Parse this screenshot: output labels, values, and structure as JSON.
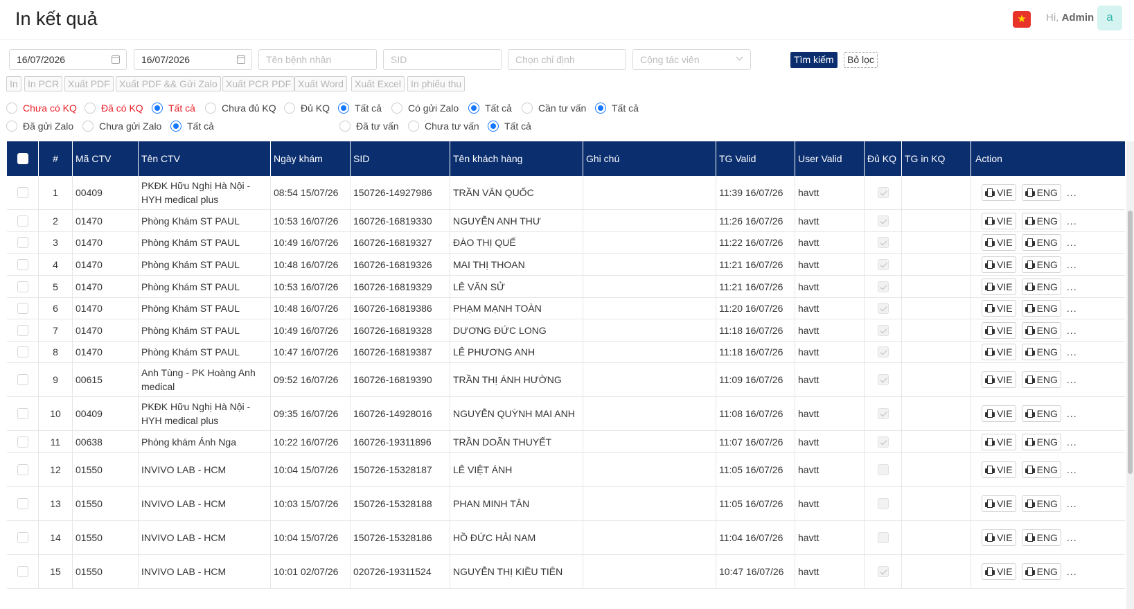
{
  "header": {
    "title": "In kết quả",
    "greeting": "Hi,",
    "user": "Admin",
    "avatar": "a",
    "flag_icon": "vietnam-flag-icon"
  },
  "filters": {
    "from_date": "16/07/2026",
    "to_date": "16/07/2026",
    "patient_placeholder": "Tên bệnh nhân",
    "sid_placeholder": "SID",
    "order_placeholder": "Chọn chỉ định",
    "ctv_placeholder": "Cộng tác viên",
    "search_label": "Tìm kiếm",
    "filter_label": "Bỏ lọc"
  },
  "toolbar": {
    "buttons": [
      "In",
      "In PCR",
      "Xuất PDF",
      "Xuất PDF && Gửi Zalo",
      "Xuất PCR PDF",
      "Xuất Word",
      "Xuất Excel",
      "In phiếu thu"
    ]
  },
  "radio_groups": [
    {
      "options": [
        {
          "label": "Chưa có KQ",
          "checked": false
        },
        {
          "label": "Đã có KQ",
          "checked": false
        },
        {
          "label": "Tất cả",
          "checked": true
        }
      ]
    },
    {
      "options": [
        {
          "label": "Chưa đủ KQ",
          "checked": false
        },
        {
          "label": "Đủ KQ",
          "checked": false
        },
        {
          "label": "Tất cả",
          "checked": true
        }
      ]
    },
    {
      "options": [
        {
          "label": "Có gửi Zalo",
          "checked": false
        },
        {
          "label": "Tất cả",
          "checked": true
        }
      ]
    },
    {
      "options": [
        {
          "label": "Cần tư vấn",
          "checked": false
        },
        {
          "label": "Tất cả",
          "checked": true
        }
      ]
    },
    {
      "options": [
        {
          "label": "Đã gửi Zalo",
          "checked": false
        },
        {
          "label": "Chưa gửi Zalo",
          "checked": false
        },
        {
          "label": "Tất cả",
          "checked": true
        }
      ]
    },
    {
      "options": [
        {
          "label": "Đã tư vấn",
          "checked": false
        },
        {
          "label": "Chưa tư vấn",
          "checked": false
        },
        {
          "label": "Tất cả",
          "checked": true
        }
      ]
    }
  ],
  "table": {
    "columns": [
      "#",
      "Mã CTV",
      "Tên CTV",
      "Ngày khám",
      "SID",
      "Tên khách hàng",
      "Ghi chú",
      "TG Valid",
      "User Valid",
      "Đủ KQ",
      "TG in KQ",
      "Action"
    ],
    "action_vie": "VIE",
    "action_eng": "ENG",
    "action_more": "...",
    "rows": [
      {
        "no": "1",
        "ma_ctv": "00409",
        "ten_ctv": "PKĐK Hữu Nghị Hà Nội - HYH medical plus",
        "ngay_kham": "08:54 15/07/26",
        "sid": "150726-14927986",
        "ten_kh": "TRẦN VĂN QUỐC",
        "ghi_chu": "",
        "tg_valid": "11:39 16/07/26",
        "user_valid": "havtt",
        "du_kq": true,
        "tg_in": ""
      },
      {
        "no": "2",
        "ma_ctv": "01470",
        "ten_ctv": "Phòng Khám ST PAUL",
        "ngay_kham": "10:53 16/07/26",
        "sid": "160726-16819330",
        "ten_kh": "NGUYỄN ANH THƯ",
        "ghi_chu": "",
        "tg_valid": "11:26 16/07/26",
        "user_valid": "havtt",
        "du_kq": true,
        "tg_in": ""
      },
      {
        "no": "3",
        "ma_ctv": "01470",
        "ten_ctv": "Phòng Khám ST PAUL",
        "ngay_kham": "10:49 16/07/26",
        "sid": "160726-16819327",
        "ten_kh": "ĐÀO THỊ QUẾ",
        "ghi_chu": "",
        "tg_valid": "11:22 16/07/26",
        "user_valid": "havtt",
        "du_kq": true,
        "tg_in": ""
      },
      {
        "no": "4",
        "ma_ctv": "01470",
        "ten_ctv": "Phòng Khám ST PAUL",
        "ngay_kham": "10:48 16/07/26",
        "sid": "160726-16819326",
        "ten_kh": "MAI THỊ THOAN",
        "ghi_chu": "",
        "tg_valid": "11:21 16/07/26",
        "user_valid": "havtt",
        "du_kq": true,
        "tg_in": ""
      },
      {
        "no": "5",
        "ma_ctv": "01470",
        "ten_ctv": "Phòng Khám ST PAUL",
        "ngay_kham": "10:53 16/07/26",
        "sid": "160726-16819329",
        "ten_kh": "LÊ VĂN SỬ",
        "ghi_chu": "",
        "tg_valid": "11:21 16/07/26",
        "user_valid": "havtt",
        "du_kq": true,
        "tg_in": ""
      },
      {
        "no": "6",
        "ma_ctv": "01470",
        "ten_ctv": "Phòng Khám ST PAUL",
        "ngay_kham": "10:48 16/07/26",
        "sid": "160726-16819386",
        "ten_kh": "PHẠM MẠNH TOÀN",
        "ghi_chu": "",
        "tg_valid": "11:20 16/07/26",
        "user_valid": "havtt",
        "du_kq": true,
        "tg_in": ""
      },
      {
        "no": "7",
        "ma_ctv": "01470",
        "ten_ctv": "Phòng Khám ST PAUL",
        "ngay_kham": "10:49 16/07/26",
        "sid": "160726-16819328",
        "ten_kh": "DƯƠNG ĐỨC LONG",
        "ghi_chu": "",
        "tg_valid": "11:18 16/07/26",
        "user_valid": "havtt",
        "du_kq": true,
        "tg_in": ""
      },
      {
        "no": "8",
        "ma_ctv": "01470",
        "ten_ctv": "Phòng Khám ST PAUL",
        "ngay_kham": "10:47 16/07/26",
        "sid": "160726-16819387",
        "ten_kh": "LÊ PHƯƠNG ANH",
        "ghi_chu": "",
        "tg_valid": "11:18 16/07/26",
        "user_valid": "havtt",
        "du_kq": true,
        "tg_in": ""
      },
      {
        "no": "9",
        "ma_ctv": "00615",
        "ten_ctv": "Anh Tùng - PK Hoàng Anh medical",
        "ngay_kham": "09:52 16/07/26",
        "sid": "160726-16819390",
        "ten_kh": "TRẦN THỊ ÁNH HƯỜNG",
        "ghi_chu": "",
        "tg_valid": "11:09 16/07/26",
        "user_valid": "havtt",
        "du_kq": true,
        "tg_in": ""
      },
      {
        "no": "10",
        "ma_ctv": "00409",
        "ten_ctv": "PKĐK Hữu Nghị Hà Nội - HYH medical plus",
        "ngay_kham": "09:35 16/07/26",
        "sid": "160726-14928016",
        "ten_kh": "NGUYỄN QUỲNH MAI ANH",
        "ghi_chu": "",
        "tg_valid": "11:08 16/07/26",
        "user_valid": "havtt",
        "du_kq": true,
        "tg_in": ""
      },
      {
        "no": "11",
        "ma_ctv": "00638",
        "ten_ctv": "Phòng khám Ánh Nga",
        "ngay_kham": "10:22 16/07/26",
        "sid": "160726-19311896",
        "ten_kh": "TRẦN DOÃN THUYẾT",
        "ghi_chu": "",
        "tg_valid": "11:07 16/07/26",
        "user_valid": "havtt",
        "du_kq": true,
        "tg_in": ""
      },
      {
        "no": "12",
        "ma_ctv": "01550",
        "ten_ctv": "INVIVO LAB - HCM",
        "ngay_kham": "10:04 15/07/26",
        "sid": "150726-15328187",
        "ten_kh": "LÊ VIỆT ÁNH",
        "ghi_chu": "",
        "tg_valid": "11:05 16/07/26",
        "user_valid": "havtt",
        "du_kq": false,
        "tg_in": ""
      },
      {
        "no": "13",
        "ma_ctv": "01550",
        "ten_ctv": "INVIVO LAB - HCM",
        "ngay_kham": "10:03 15/07/26",
        "sid": "150726-15328188",
        "ten_kh": "PHAN MINH TÂN",
        "ghi_chu": "",
        "tg_valid": "11:05 16/07/26",
        "user_valid": "havtt",
        "du_kq": false,
        "tg_in": ""
      },
      {
        "no": "14",
        "ma_ctv": "01550",
        "ten_ctv": "INVIVO LAB - HCM",
        "ngay_kham": "10:04 15/07/26",
        "sid": "150726-15328186",
        "ten_kh": "HỒ ĐỨC HẢI NAM",
        "ghi_chu": "",
        "tg_valid": "11:04 16/07/26",
        "user_valid": "havtt",
        "du_kq": false,
        "tg_in": ""
      },
      {
        "no": "15",
        "ma_ctv": "01550",
        "ten_ctv": "INVIVO LAB - HCM",
        "ngay_kham": "10:01 02/07/26",
        "sid": "020726-19311524",
        "ten_kh": "NGUYỄN THỊ KIỀU TIÊN",
        "ghi_chu": "",
        "tg_valid": "10:47 16/07/26",
        "user_valid": "havtt",
        "du_kq": true,
        "tg_in": ""
      }
    ]
  }
}
